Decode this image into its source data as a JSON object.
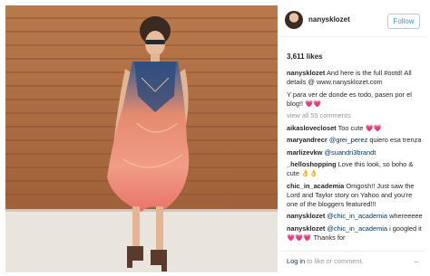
{
  "post": {
    "username": "nanysklozet",
    "follow_label": "Follow",
    "likes": "3,611 likes"
  },
  "comments": [
    {
      "user": "nanysklozet",
      "text": " And here is the full #ootd! All details @ www.nanysklozet.com"
    },
    {
      "user": "",
      "text": "Y para ver de donde es todo, pasen por el blog!! ",
      "emoji": "💗💗"
    },
    {
      "view_all": "view all 55 comments"
    },
    {
      "user": "aikaslovecloset",
      "text": " Too cute ",
      "emoji": "💗💗"
    },
    {
      "user": "maryandrecr",
      "mention": " @grei_perez",
      "text": " quiero esa trenza"
    },
    {
      "user": "marlizevkw",
      "mention": " @suandri3brandt",
      "text": ""
    },
    {
      "user": "_helloshopping",
      "text": " Love this look, so boho & cute ",
      "emoji": "👌👌"
    },
    {
      "user": "chic_in_academia",
      "text": " Omgosh!! Just saw the Lord and Taylor story on Yahoo and you're one of the bloggers featured!!!"
    },
    {
      "user": "nanysklozet",
      "mention": " @chic_in_academia",
      "text": " whereeeee"
    },
    {
      "user": "nanysklozet",
      "mention": " @chic_in_academia",
      "text": " i googled it ",
      "emoji": "💗💗💗",
      "text2": " Thanks for"
    }
  ],
  "footer": {
    "login": "Log in",
    "rest": " to like or comment.",
    "more": "..."
  },
  "colors": {
    "link": "#003569",
    "follow": "#3897f0",
    "muted": "#999999",
    "wood": "#b06a3c"
  }
}
